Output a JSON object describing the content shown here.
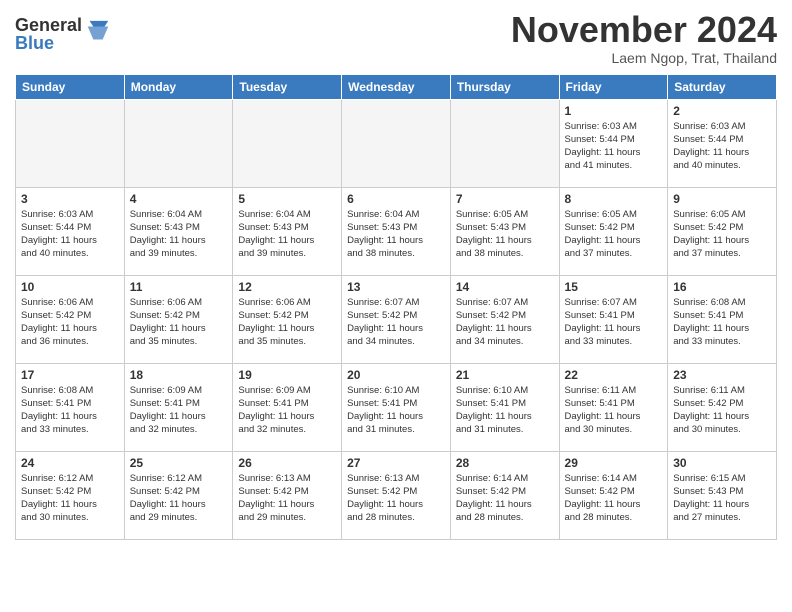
{
  "logo": {
    "general": "General",
    "blue": "Blue"
  },
  "header": {
    "month": "November 2024",
    "location": "Laem Ngop, Trat, Thailand"
  },
  "weekdays": [
    "Sunday",
    "Monday",
    "Tuesday",
    "Wednesday",
    "Thursday",
    "Friday",
    "Saturday"
  ],
  "weeks": [
    [
      {
        "day": "",
        "empty": true
      },
      {
        "day": "",
        "empty": true
      },
      {
        "day": "",
        "empty": true
      },
      {
        "day": "",
        "empty": true
      },
      {
        "day": "",
        "empty": true
      },
      {
        "day": "1",
        "sunrise": "6:03 AM",
        "sunset": "5:44 PM",
        "daylight": "11 hours and 41 minutes."
      },
      {
        "day": "2",
        "sunrise": "6:03 AM",
        "sunset": "5:44 PM",
        "daylight": "11 hours and 40 minutes."
      }
    ],
    [
      {
        "day": "3",
        "sunrise": "6:03 AM",
        "sunset": "5:44 PM",
        "daylight": "11 hours and 40 minutes."
      },
      {
        "day": "4",
        "sunrise": "6:04 AM",
        "sunset": "5:43 PM",
        "daylight": "11 hours and 39 minutes."
      },
      {
        "day": "5",
        "sunrise": "6:04 AM",
        "sunset": "5:43 PM",
        "daylight": "11 hours and 39 minutes."
      },
      {
        "day": "6",
        "sunrise": "6:04 AM",
        "sunset": "5:43 PM",
        "daylight": "11 hours and 38 minutes."
      },
      {
        "day": "7",
        "sunrise": "6:05 AM",
        "sunset": "5:43 PM",
        "daylight": "11 hours and 38 minutes."
      },
      {
        "day": "8",
        "sunrise": "6:05 AM",
        "sunset": "5:42 PM",
        "daylight": "11 hours and 37 minutes."
      },
      {
        "day": "9",
        "sunrise": "6:05 AM",
        "sunset": "5:42 PM",
        "daylight": "11 hours and 37 minutes."
      }
    ],
    [
      {
        "day": "10",
        "sunrise": "6:06 AM",
        "sunset": "5:42 PM",
        "daylight": "11 hours and 36 minutes."
      },
      {
        "day": "11",
        "sunrise": "6:06 AM",
        "sunset": "5:42 PM",
        "daylight": "11 hours and 35 minutes."
      },
      {
        "day": "12",
        "sunrise": "6:06 AM",
        "sunset": "5:42 PM",
        "daylight": "11 hours and 35 minutes."
      },
      {
        "day": "13",
        "sunrise": "6:07 AM",
        "sunset": "5:42 PM",
        "daylight": "11 hours and 34 minutes."
      },
      {
        "day": "14",
        "sunrise": "6:07 AM",
        "sunset": "5:42 PM",
        "daylight": "11 hours and 34 minutes."
      },
      {
        "day": "15",
        "sunrise": "6:07 AM",
        "sunset": "5:41 PM",
        "daylight": "11 hours and 33 minutes."
      },
      {
        "day": "16",
        "sunrise": "6:08 AM",
        "sunset": "5:41 PM",
        "daylight": "11 hours and 33 minutes."
      }
    ],
    [
      {
        "day": "17",
        "sunrise": "6:08 AM",
        "sunset": "5:41 PM",
        "daylight": "11 hours and 33 minutes."
      },
      {
        "day": "18",
        "sunrise": "6:09 AM",
        "sunset": "5:41 PM",
        "daylight": "11 hours and 32 minutes."
      },
      {
        "day": "19",
        "sunrise": "6:09 AM",
        "sunset": "5:41 PM",
        "daylight": "11 hours and 32 minutes."
      },
      {
        "day": "20",
        "sunrise": "6:10 AM",
        "sunset": "5:41 PM",
        "daylight": "11 hours and 31 minutes."
      },
      {
        "day": "21",
        "sunrise": "6:10 AM",
        "sunset": "5:41 PM",
        "daylight": "11 hours and 31 minutes."
      },
      {
        "day": "22",
        "sunrise": "6:11 AM",
        "sunset": "5:41 PM",
        "daylight": "11 hours and 30 minutes."
      },
      {
        "day": "23",
        "sunrise": "6:11 AM",
        "sunset": "5:42 PM",
        "daylight": "11 hours and 30 minutes."
      }
    ],
    [
      {
        "day": "24",
        "sunrise": "6:12 AM",
        "sunset": "5:42 PM",
        "daylight": "11 hours and 30 minutes."
      },
      {
        "day": "25",
        "sunrise": "6:12 AM",
        "sunset": "5:42 PM",
        "daylight": "11 hours and 29 minutes."
      },
      {
        "day": "26",
        "sunrise": "6:13 AM",
        "sunset": "5:42 PM",
        "daylight": "11 hours and 29 minutes."
      },
      {
        "day": "27",
        "sunrise": "6:13 AM",
        "sunset": "5:42 PM",
        "daylight": "11 hours and 28 minutes."
      },
      {
        "day": "28",
        "sunrise": "6:14 AM",
        "sunset": "5:42 PM",
        "daylight": "11 hours and 28 minutes."
      },
      {
        "day": "29",
        "sunrise": "6:14 AM",
        "sunset": "5:42 PM",
        "daylight": "11 hours and 28 minutes."
      },
      {
        "day": "30",
        "sunrise": "6:15 AM",
        "sunset": "5:43 PM",
        "daylight": "11 hours and 27 minutes."
      }
    ]
  ]
}
